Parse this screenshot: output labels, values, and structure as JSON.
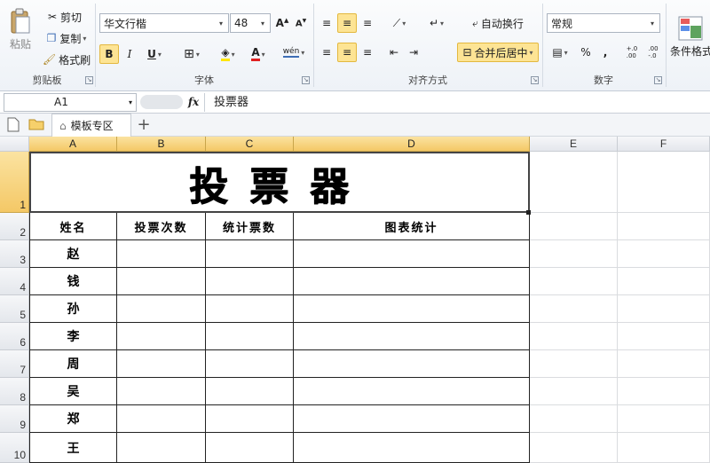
{
  "ribbon": {
    "clipboard": {
      "paste": "粘贴",
      "cut": "剪切",
      "copy": "复制",
      "format_painter": "格式刷",
      "group": "剪贴板"
    },
    "font": {
      "name": "华文行楷",
      "size": "48",
      "bold": "B",
      "italic": "I",
      "underline": "U",
      "group": "字体",
      "phonetic": "wén"
    },
    "alignment": {
      "wrap": "自动换行",
      "merge": "合并后居中",
      "group": "对齐方式"
    },
    "number": {
      "format": "常规",
      "percent": "%",
      "comma": ",",
      "inc_dec": "←.0 .00",
      "dec_dec": ".00 →.0",
      "group": "数字"
    },
    "styles": {
      "conditional": "条件格式"
    }
  },
  "formula_bar": {
    "name_box": "A1",
    "fx": "fx",
    "content": "投票器"
  },
  "toolbar2": {
    "tab": "模板专区",
    "add": "+"
  },
  "sheet": {
    "columns": [
      "A",
      "B",
      "C",
      "D",
      "E",
      "F"
    ],
    "rows": [
      "1",
      "2",
      "3",
      "4",
      "5",
      "6",
      "7",
      "8",
      "9",
      "10"
    ],
    "title": "投票器",
    "headers": [
      "姓名",
      "投票次数",
      "统计票数",
      "图表统计"
    ],
    "names": [
      "赵",
      "钱",
      "孙",
      "李",
      "周",
      "吴",
      "郑",
      "王"
    ]
  },
  "colors": {
    "accent": "#fde494",
    "selected_header": "#f4c866"
  }
}
